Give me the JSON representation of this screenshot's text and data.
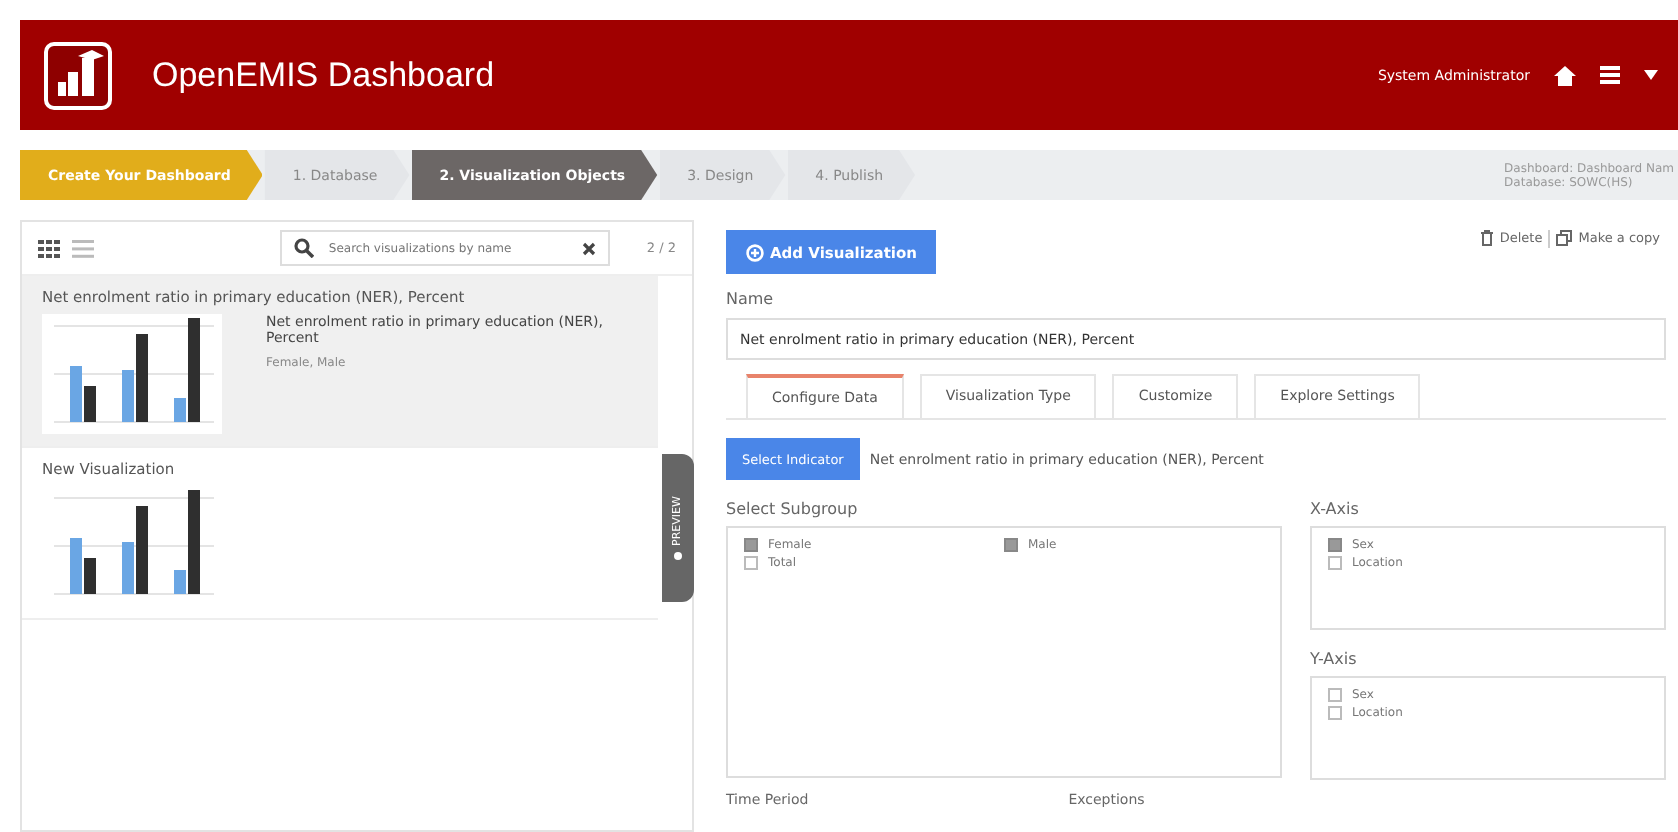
{
  "header": {
    "title": "OpenEMIS Dashboard",
    "user": "System Administrator"
  },
  "steps": [
    {
      "label": "Create Your Dashboard",
      "kind": "title"
    },
    {
      "label": "1. Database",
      "kind": "step",
      "selected": false
    },
    {
      "label": "2. Visualization Objects",
      "kind": "step",
      "selected": true
    },
    {
      "label": "3. Design",
      "kind": "step",
      "selected": false
    },
    {
      "label": "4. Publish",
      "kind": "step",
      "selected": false
    }
  ],
  "dashboard_info": [
    "Dashboard: Dashboard Nam",
    "Database: SOWC(HS)"
  ],
  "sidebar": {
    "search": {
      "placeholder": "Search visualizations by name"
    },
    "count": "2 / 2",
    "items": [
      {
        "title": "Net enrolment ratio in primary education (NER), Percent",
        "detail_title": "Net enrolment ratio in primary education (NER), Percent",
        "detail_sub": "Female, Male",
        "selected": true
      },
      {
        "title": "New Visualization",
        "selected": false
      }
    ],
    "preview_tab": "PREVIEW"
  },
  "editor": {
    "add_button": "Add Visualization",
    "actions": [
      "Delete",
      "Make a copy"
    ],
    "name_label": "Name",
    "name_value": "Net enrolment ratio in primary education (NER), Percent",
    "tabs": [
      {
        "label": "Configure Data",
        "selected": true
      },
      {
        "label": "Visualization Type",
        "selected": false
      },
      {
        "label": "Customize",
        "selected": false
      },
      {
        "label": "Explore Settings",
        "selected": false
      }
    ],
    "indicator_button": "Select Indicator",
    "indicator_value": "Net enrolment ratio in primary education (NER), Percent",
    "subgroup": {
      "label": "Select Subgroup",
      "options": [
        {
          "label": "Female",
          "checked": true
        },
        {
          "label": "Male",
          "checked": true
        },
        {
          "label": "Total",
          "checked": false
        }
      ]
    },
    "x_axis": {
      "label": "X-Axis",
      "options": [
        {
          "label": "Sex",
          "checked": true
        },
        {
          "label": "Location",
          "checked": false
        }
      ]
    },
    "y_axis": {
      "label": "Y-Axis",
      "options": [
        {
          "label": "Sex",
          "checked": false
        },
        {
          "label": "Location",
          "checked": false
        }
      ]
    },
    "bottom_labels": [
      "Time Period",
      "Exceptions"
    ]
  }
}
